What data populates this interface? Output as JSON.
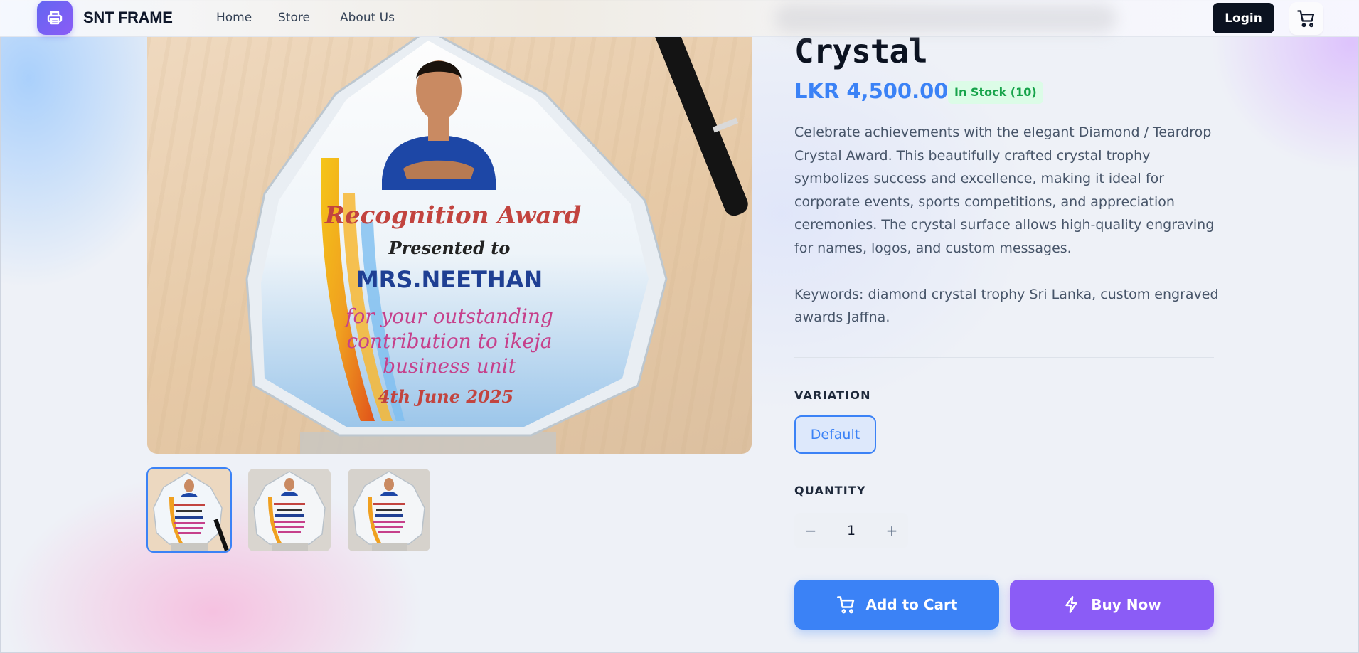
{
  "nav": {
    "brand": "SNT FRAME",
    "links": [
      "Home",
      "Store",
      "About Us"
    ],
    "login_label": "Login",
    "logo_icon": "printer-icon",
    "cart_icon": "shopping-cart-icon"
  },
  "product": {
    "title": "Crystal",
    "price": "LKR 4,500.00",
    "stock": "In Stock (10)",
    "description": "Celebrate achievements with the elegant Diamond / Teardrop Crystal Award. This beautifully crafted crystal trophy symbolizes success and excellence, making it ideal for corporate events, sports competitions, and appreciation ceremonies. The crystal surface allows high-quality engraving for names, logos, and custom messages.\n\nKeywords: diamond crystal trophy Sri Lanka, custom engraved awards Jaffna.",
    "image": {
      "award_title": "Recognition Award",
      "presented_to": "Presented to",
      "recipient": "MRS.NEETHAN",
      "message_line1": "for your outstanding",
      "message_line2": "contribution to ikeja",
      "message_line3": "business unit",
      "date": "4th June 2025"
    },
    "thumbnails": 3,
    "active_thumbnail": 1
  },
  "variation": {
    "label": "VARIATION",
    "options": [
      "Default"
    ],
    "selected": "Default"
  },
  "quantity": {
    "label": "QUANTITY",
    "minus": "−",
    "plus": "+",
    "value": "1"
  },
  "actions": {
    "add_to_cart": "Add to Cart",
    "buy_now": "Buy Now"
  },
  "colors": {
    "accent_blue": "#3b82f6",
    "accent_purple": "#8b5cf6",
    "stock_green": "#16a34a"
  }
}
